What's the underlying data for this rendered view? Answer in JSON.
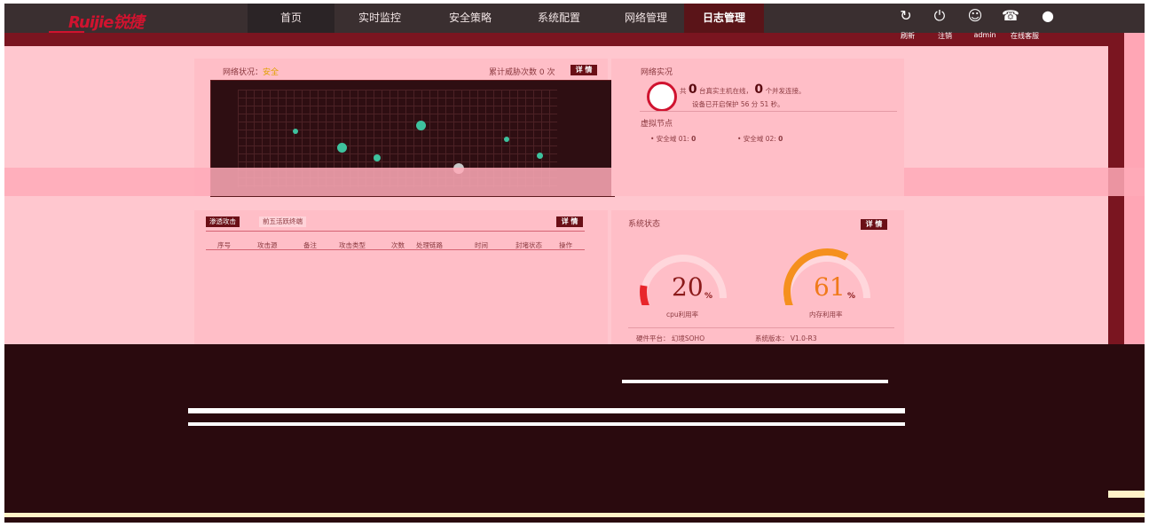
{
  "brand": {
    "logo": "Ruijie锐捷"
  },
  "nav": {
    "items": [
      "首页",
      "实时监控",
      "安全策略",
      "系统配置",
      "网络管理",
      "日志管理"
    ]
  },
  "top_actions": [
    {
      "icon": "refresh-icon",
      "label": "刷新"
    },
    {
      "icon": "logout-icon",
      "label": "注销"
    },
    {
      "icon": "user-icon",
      "label": "admin"
    },
    {
      "icon": "support-icon",
      "label": "在线客服"
    }
  ],
  "network_status": {
    "title_label": "网络状况：",
    "title_value": "安全",
    "threat_label": "累计威胁次数",
    "threat_count": "0 次",
    "detail": "详 情"
  },
  "network_live": {
    "title": "网络实况",
    "prefix": "共",
    "hosts_online": "0",
    "hosts_text": "台真实主机在线，",
    "concurrent": "0",
    "concurrent_text": "个并发连接。",
    "protect_text": "设备已开启保护 56 分 51 秒。",
    "virtual_nodes_title": "虚拟节点",
    "domains": [
      {
        "label": "• 安全域 01:",
        "value": "0"
      },
      {
        "label": "• 安全域 02:",
        "value": "0"
      }
    ]
  },
  "attack_panel": {
    "tabs": [
      "渗透攻击",
      "前五活跃终端"
    ],
    "detail": "详 情",
    "columns": [
      "序号",
      "攻击源",
      "备注",
      "攻击类型",
      "次数",
      "处理链路",
      "时间",
      "封堵状态",
      "操作"
    ]
  },
  "system_status": {
    "title": "系统状态",
    "detail": "详 情",
    "cpu": {
      "value": "20",
      "unit": "%",
      "label": "cpu利用率",
      "fraction": 0.2
    },
    "memory": {
      "value": "61",
      "unit": "%",
      "label": "内存利用率",
      "fraction": 0.61
    },
    "hardware_label": "硬件平台：",
    "hardware_value": "幻境SOHO",
    "version_label": "系统版本：",
    "version_value": "V1.0-R3"
  },
  "colors": {
    "accent": "#d0132f",
    "cpu_gauge": "#e8262b",
    "mem_gauge": "#f5901e",
    "panel": "#ffbec7"
  }
}
